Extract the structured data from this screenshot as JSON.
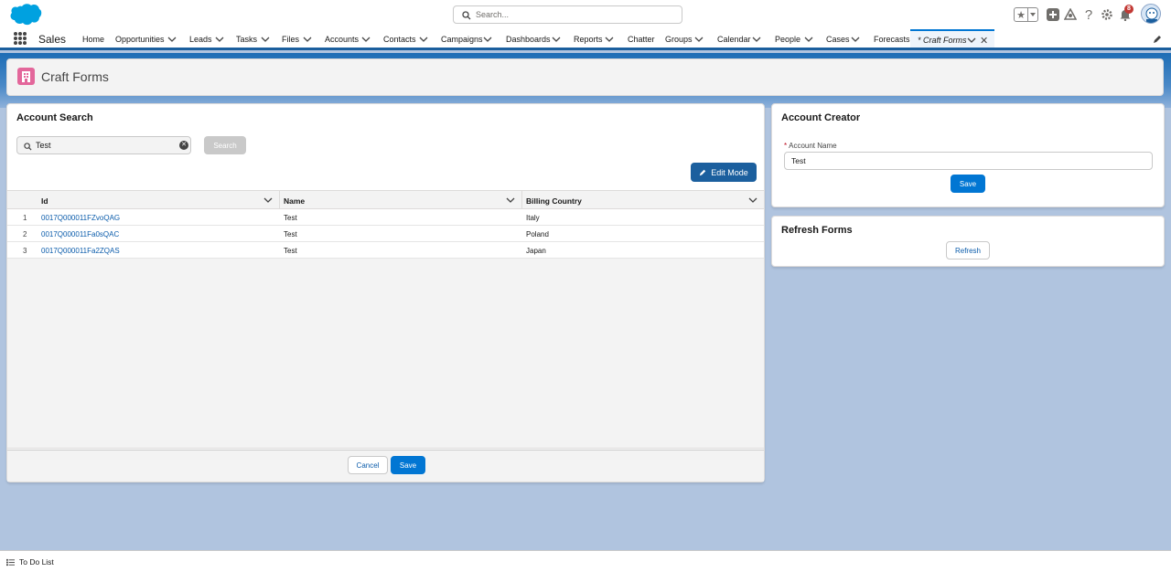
{
  "header": {
    "search_placeholder": "Search...",
    "notification_count": "8"
  },
  "nav": {
    "app_name": "Sales",
    "items": [
      {
        "label": "Home"
      },
      {
        "label": "Opportunities"
      },
      {
        "label": "Leads"
      },
      {
        "label": "Tasks"
      },
      {
        "label": "Files"
      },
      {
        "label": "Accounts"
      },
      {
        "label": "Contacts"
      },
      {
        "label": "Campaigns"
      },
      {
        "label": "Dashboards"
      },
      {
        "label": "Reports"
      },
      {
        "label": "Chatter"
      },
      {
        "label": "Groups"
      },
      {
        "label": "Calendar"
      },
      {
        "label": "People"
      },
      {
        "label": "Cases"
      },
      {
        "label": "Forecasts"
      }
    ],
    "active_tab": "* Craft Forms"
  },
  "page": {
    "title": "Craft Forms"
  },
  "account_search": {
    "title": "Account Search",
    "search_value": "Test",
    "search_button": "Search",
    "edit_mode_button": "Edit Mode",
    "columns": [
      "Id",
      "Name",
      "Billing Country"
    ],
    "rows": [
      {
        "num": "1",
        "id": "0017Q000011FZvoQAG",
        "name": "Test",
        "country": "Italy"
      },
      {
        "num": "2",
        "id": "0017Q000011Fa0sQAC",
        "name": "Test",
        "country": "Poland"
      },
      {
        "num": "3",
        "id": "0017Q000011Fa2ZQAS",
        "name": "Test",
        "country": "Japan"
      }
    ],
    "cancel_button": "Cancel",
    "save_button": "Save"
  },
  "account_creator": {
    "title": "Account Creator",
    "field_required_mark": "*",
    "field_label": "Account Name",
    "field_value": "Test",
    "save_button": "Save"
  },
  "refresh_forms": {
    "title": "Refresh Forms",
    "refresh_button": "Refresh"
  },
  "utility": {
    "todo_label": "To Do List"
  },
  "colors": {
    "brand": "#0176d3",
    "nav_border": "#1b5f9e",
    "page_icon": "#e3679b",
    "link": "#0b5cab"
  }
}
